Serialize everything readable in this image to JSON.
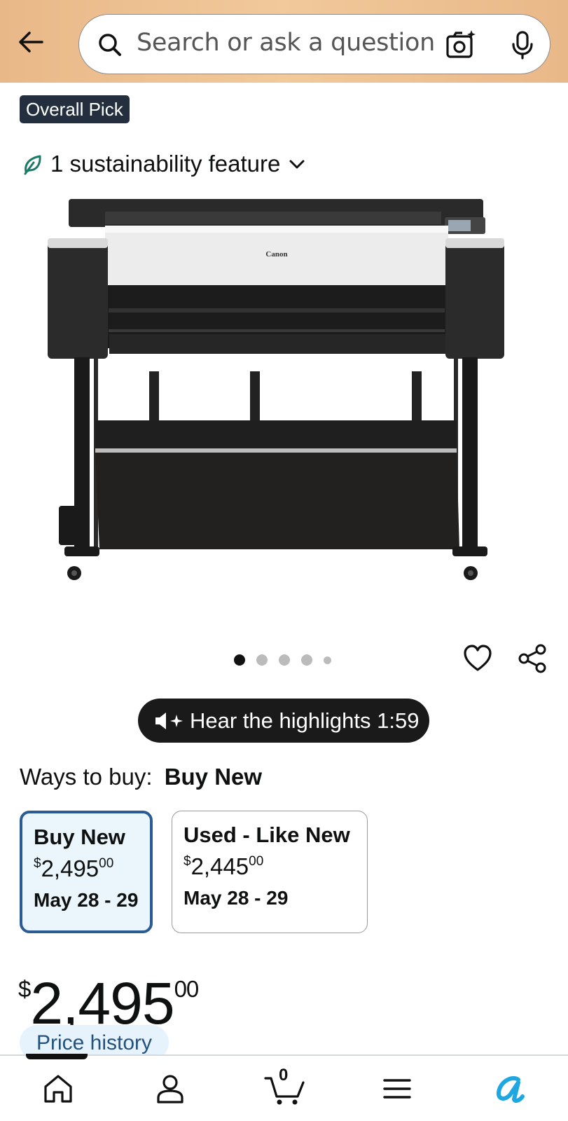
{
  "header": {
    "search": {
      "placeholder": "Search or ask a question"
    }
  },
  "badge": {
    "label": "Overall Pick"
  },
  "sustainability": {
    "label": "1 sustainability feature"
  },
  "product_image": {
    "alt": "Canon"
  },
  "carousel": {
    "dot_count": 5,
    "active_index": 0
  },
  "highlights": {
    "label": "Hear the highlights 1:59"
  },
  "ways_to_buy": {
    "label": "Ways to buy:",
    "selected": "Buy New",
    "options": [
      {
        "title": "Buy New",
        "currency": "$",
        "price_whole": "2,495",
        "price_fraction": "00",
        "delivery": "May 28 - 29"
      },
      {
        "title": "Used - Like New",
        "currency": "$",
        "price_whole": "2,445",
        "price_fraction": "00",
        "delivery": "May 28 - 29"
      }
    ]
  },
  "price": {
    "currency": "$",
    "whole": "2,495",
    "fraction": "00"
  },
  "price_history": {
    "label": "Price history"
  },
  "bottom_nav": {
    "cart_count": "0"
  },
  "colors": {
    "header_bg": "#f1c99b",
    "selected_border": "#2a5b92",
    "pill_bg": "#1a1a1a",
    "badge_bg": "#232f3e",
    "leaf": "#1e7a68",
    "ai_icon": "#1ea7e1"
  }
}
